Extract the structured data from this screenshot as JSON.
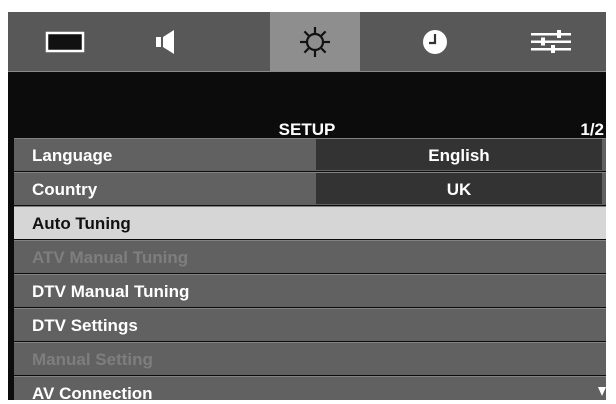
{
  "tabs": [
    {
      "icon": "picture-icon",
      "active": false
    },
    {
      "icon": "sound-icon",
      "active": false
    },
    {
      "icon": "setup-gear-icon",
      "active": true
    },
    {
      "icon": "clock-icon",
      "active": false
    },
    {
      "icon": "options-sliders-icon",
      "active": false
    }
  ],
  "menu": {
    "title": "SETUP",
    "page": "1/2"
  },
  "items": [
    {
      "label": "Language",
      "value": "English",
      "state": "normal"
    },
    {
      "label": "Country",
      "value": "UK",
      "state": "normal"
    },
    {
      "label": "Auto Tuning",
      "state": "selected"
    },
    {
      "label": "ATV Manual Tuning",
      "state": "disabled"
    },
    {
      "label": "DTV Manual Tuning",
      "state": "normal"
    },
    {
      "label": "DTV Settings",
      "state": "normal"
    },
    {
      "label": "Manual Setting",
      "state": "disabled"
    },
    {
      "label": "AV Connection",
      "state": "normal"
    }
  ],
  "colors": {
    "background": "#0c0c0c",
    "tab_bar": "#585858",
    "tab_active": "#8e8e8e",
    "row": "#616161",
    "row_selected": "#d6d6d6",
    "value_box": "#333333",
    "text_disabled": "#7e7e7e"
  }
}
